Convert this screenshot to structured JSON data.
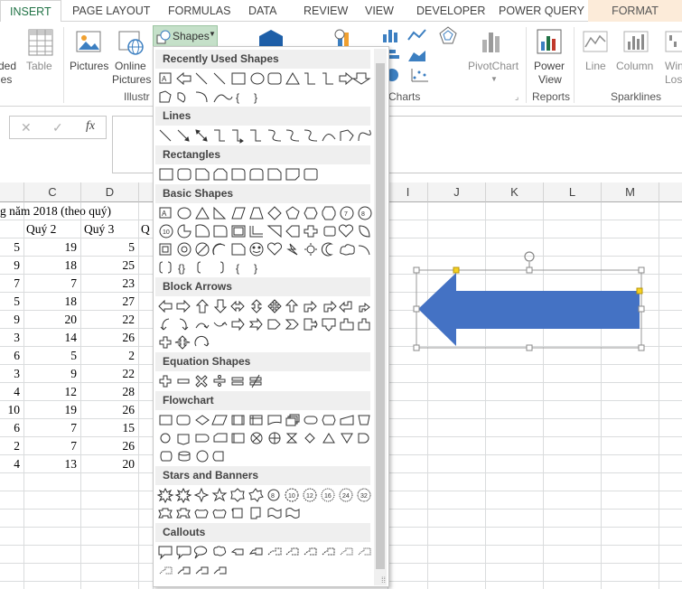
{
  "tabs": [
    "INSERT",
    "PAGE LAYOUT",
    "FORMULAS",
    "DATA",
    "REVIEW",
    "VIEW",
    "DEVELOPER",
    "POWER QUERY",
    "FORMAT"
  ],
  "ribbon": {
    "pivot_left": "ded",
    "pivot_left2": "les",
    "table": "Table",
    "pictures": "Pictures",
    "online": "Online",
    "online2": "Pictures",
    "shapes": "Shapes",
    "illustrations": "Illustr",
    "charts_group": "Charts",
    "pivotchart": "PivotChart",
    "power": "Power",
    "view": "View",
    "reports": "Reports",
    "line": "Line",
    "column": "Column",
    "win": "Win",
    "loss": "Loss",
    "sparklines": "Sparklines"
  },
  "formula_bar": {
    "cancel": "✕",
    "enter": "✓",
    "fx": "fx"
  },
  "columns": [
    "C",
    "D",
    "I",
    "J",
    "K",
    "L",
    "M"
  ],
  "sheet": {
    "title_fragment": "g năm 2018 (theo quý)",
    "q_fragment": "Q",
    "headers": [
      "Quý 2",
      "Quý 3"
    ],
    "rows": [
      {
        "b": "5",
        "c": "19",
        "d": "5"
      },
      {
        "b": "9",
        "c": "18",
        "d": "25"
      },
      {
        "b": "7",
        "c": "7",
        "d": "23"
      },
      {
        "b": "5",
        "c": "18",
        "d": "27"
      },
      {
        "b": "9",
        "c": "20",
        "d": "22"
      },
      {
        "b": "3",
        "c": "14",
        "d": "26"
      },
      {
        "b": "6",
        "c": "5",
        "d": "2"
      },
      {
        "b": "3",
        "c": "9",
        "d": "22"
      },
      {
        "b": "4",
        "c": "12",
        "d": "28"
      },
      {
        "b": "10",
        "c": "19",
        "d": "26"
      },
      {
        "b": "6",
        "c": "7",
        "d": "15"
      },
      {
        "b": "2",
        "c": "7",
        "d": "26"
      },
      {
        "b": "4",
        "c": "13",
        "d": "20"
      }
    ]
  },
  "dropdown": {
    "sections": [
      "Recently Used Shapes",
      "Lines",
      "Rectangles",
      "Basic Shapes",
      "Block Arrows",
      "Equation Shapes",
      "Flowchart",
      "Stars and Banners",
      "Callouts"
    ]
  },
  "colors": {
    "accent": "#217346",
    "arrow": "#4472c4",
    "format_tab": "#fcebd9"
  }
}
